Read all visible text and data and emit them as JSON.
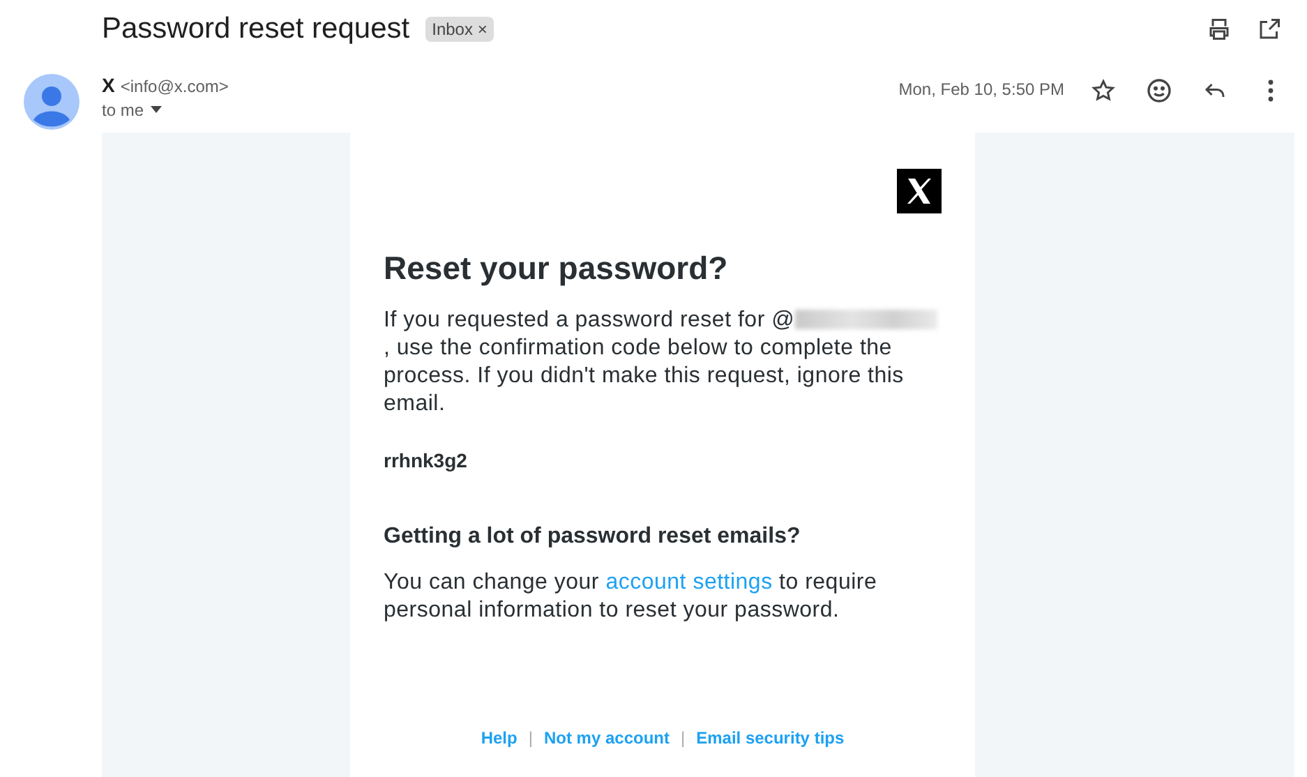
{
  "subject": "Password reset request",
  "labels": [
    {
      "text": "Inbox",
      "remove": "×"
    }
  ],
  "sender": {
    "name": "X",
    "email": "<info@x.com>",
    "recipient": "to me"
  },
  "date": "Mon, Feb 10, 5:50 PM",
  "starred": false,
  "email": {
    "heading": "Reset your password?",
    "paragraph": {
      "before": "If you requested a password reset for @",
      "redacted": true,
      "after": ", use the confirmation code below to complete the process. If you didn't make this request, ignore this email."
    },
    "code": "rrhnk3g2",
    "subheading": "Getting a lot of password reset emails?",
    "settings_text": {
      "before": "You can change your ",
      "link": "account settings",
      "after": " to require personal information to reset your password."
    },
    "footer_links": [
      {
        "text": "Help"
      },
      {
        "text": "Not my account"
      },
      {
        "text": "Email security tips"
      }
    ],
    "separator": "|"
  }
}
